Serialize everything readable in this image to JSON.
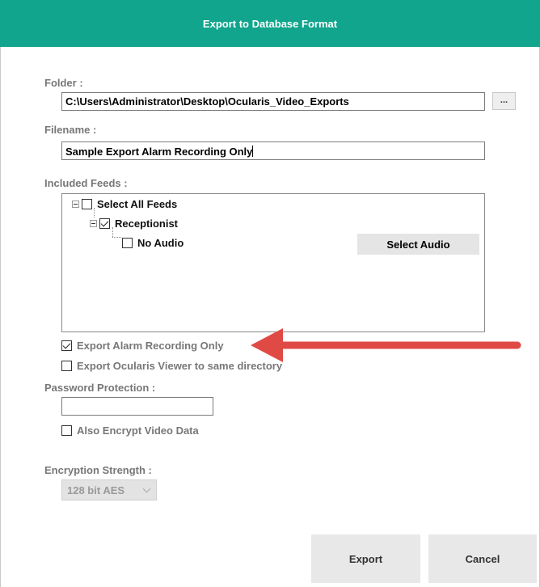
{
  "window": {
    "title": "Export to Database Format"
  },
  "folder": {
    "label": "Folder :",
    "value": "C:\\Users\\Administrator\\Desktop\\Ocularis_Video_Exports",
    "browse_label": "..."
  },
  "filename": {
    "label": "Filename :",
    "value": "Sample Export Alarm Recording Only"
  },
  "feeds": {
    "label": "Included Feeds :",
    "select_all": {
      "label": "Select All Feeds",
      "checked": false
    },
    "camera": {
      "label": "Receptionist",
      "checked": true
    },
    "audio": {
      "label": "No Audio",
      "checked": false
    },
    "select_audio_label": "Select Audio"
  },
  "options": {
    "alarm_only": {
      "label": "Export Alarm Recording Only",
      "checked": true
    },
    "viewer": {
      "label": "Export Ocularis Viewer to same directory",
      "checked": false
    }
  },
  "password": {
    "label": "Password Protection :",
    "value": ""
  },
  "encrypt_video": {
    "label": "Also Encrypt Video Data",
    "checked": false
  },
  "encryption": {
    "label": "Encryption Strength :",
    "selected": "128 bit AES"
  },
  "buttons": {
    "export": "Export",
    "cancel": "Cancel"
  },
  "colors": {
    "titlebar": "#10a58c",
    "annotation_arrow": "#e04a45"
  }
}
